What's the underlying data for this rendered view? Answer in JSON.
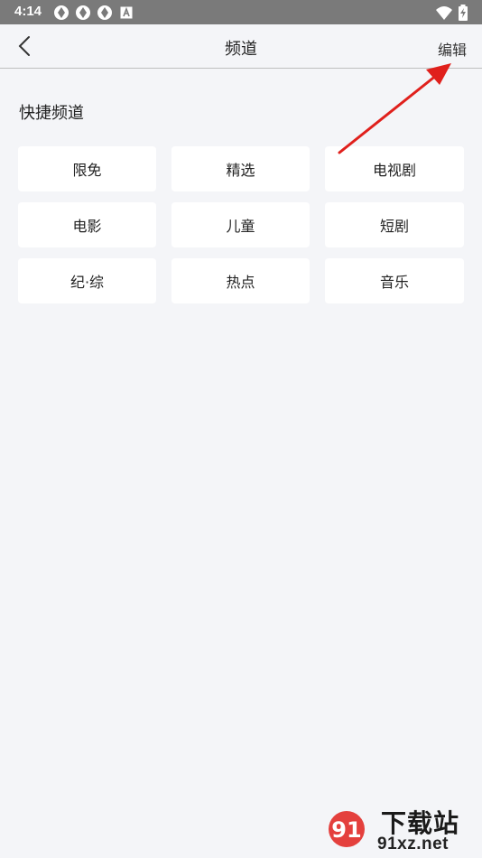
{
  "status_bar": {
    "time": "4:14",
    "left_icons": [
      "aperture-icon",
      "aperture-icon",
      "aperture-icon",
      "a-badge-icon"
    ],
    "right_icons": [
      "wifi-icon",
      "battery-charging-icon"
    ]
  },
  "nav": {
    "title": "频道",
    "edit_label": "编辑",
    "back_icon": "chevron-left-icon"
  },
  "section": {
    "title": "快捷频道"
  },
  "channels": [
    {
      "label": "限免"
    },
    {
      "label": "精选"
    },
    {
      "label": "电视剧"
    },
    {
      "label": "电影"
    },
    {
      "label": "儿童"
    },
    {
      "label": "短剧"
    },
    {
      "label": "纪·综"
    },
    {
      "label": "热点"
    },
    {
      "label": "音乐"
    }
  ],
  "annotation": {
    "arrow_color": "#e0201c"
  },
  "watermark": {
    "title": "下载站",
    "url": "91xz.net",
    "logo_text": "91",
    "accent_color": "#e0201c"
  }
}
